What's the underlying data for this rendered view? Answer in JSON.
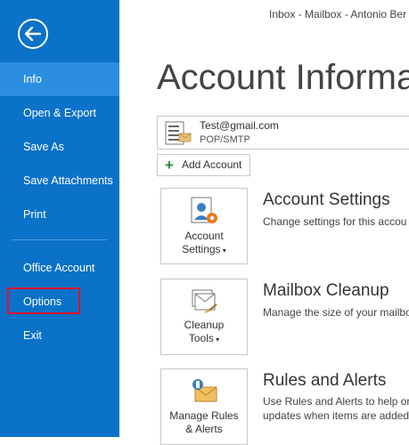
{
  "window": {
    "title": "Inbox - Mailbox - Antonio Ber"
  },
  "sidebar": {
    "back_icon": "back-arrow-icon",
    "items": [
      {
        "label": "Info",
        "active": true
      },
      {
        "label": "Open & Export"
      },
      {
        "label": "Save As"
      },
      {
        "label": "Save Attachments"
      },
      {
        "label": "Print"
      },
      {
        "label": "Office Account"
      },
      {
        "label": "Options"
      },
      {
        "label": "Exit"
      }
    ]
  },
  "main": {
    "title": "Account Informat",
    "account": {
      "email": "Test@gmail.com",
      "type": "POP/SMTP"
    },
    "add_account_label": "Add Account",
    "sections": [
      {
        "tile_line1": "Account",
        "tile_line2": "Settings",
        "title": "Account Settings",
        "desc1": "Change settings for this accou",
        "desc2": ""
      },
      {
        "tile_line1": "Cleanup",
        "tile_line2": "Tools",
        "title": "Mailbox Cleanup",
        "desc1": "Manage the size of your mailbo",
        "desc2": ""
      },
      {
        "tile_line1": "Manage Rules",
        "tile_line2": "& Alerts",
        "title": "Rules and Alerts",
        "desc1": "Use Rules and Alerts to help org",
        "desc2": "updates when items are added,"
      }
    ]
  },
  "colors": {
    "sidebar": "#0a72c8",
    "active_item": "#2b8ee0",
    "highlight": "#e8102a"
  }
}
